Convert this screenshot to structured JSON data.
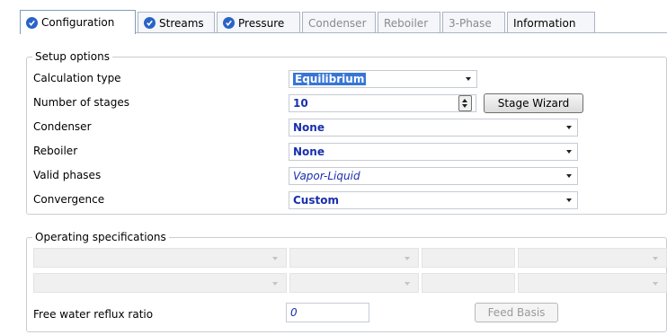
{
  "tabs": [
    {
      "label": "Configuration",
      "checked": true,
      "active": true,
      "disabled": false
    },
    {
      "label": "Streams",
      "checked": true,
      "active": false,
      "disabled": false
    },
    {
      "label": "Pressure",
      "checked": true,
      "active": false,
      "disabled": false
    },
    {
      "label": "Condenser",
      "checked": false,
      "active": false,
      "disabled": true
    },
    {
      "label": "Reboiler",
      "checked": false,
      "active": false,
      "disabled": true
    },
    {
      "label": "3-Phase",
      "checked": false,
      "active": false,
      "disabled": true
    },
    {
      "label": "Information",
      "checked": false,
      "active": false,
      "disabled": false
    }
  ],
  "setup": {
    "title": "Setup options",
    "calc_type": {
      "label": "Calculation type",
      "value": "Equilibrium"
    },
    "stages": {
      "label": "Number of stages",
      "value": "10",
      "wizard_label": "Stage Wizard"
    },
    "condenser": {
      "label": "Condenser",
      "value": "None"
    },
    "reboiler": {
      "label": "Reboiler",
      "value": "None"
    },
    "valid_phases": {
      "label": "Valid phases",
      "value": "Vapor-Liquid"
    },
    "convergence": {
      "label": "Convergence",
      "value": "Custom"
    }
  },
  "operating": {
    "title": "Operating specifications",
    "free_water": {
      "label": "Free water reflux ratio",
      "value": "0"
    },
    "feed_basis_label": "Feed Basis"
  },
  "colors": {
    "accent": "#2a63c7",
    "value_text": "#1a2fae",
    "selection": "#3776d6"
  }
}
